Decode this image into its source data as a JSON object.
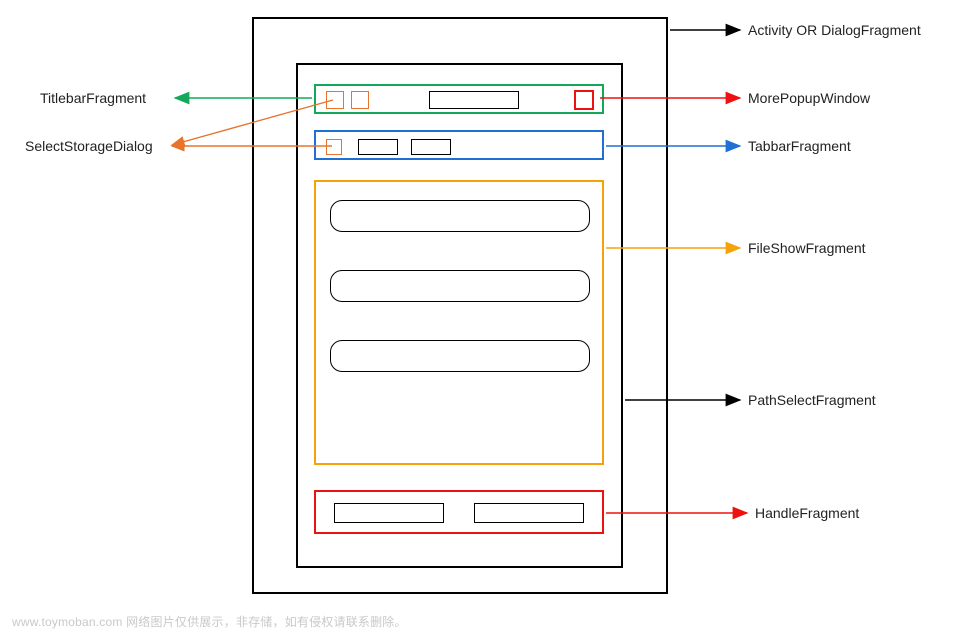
{
  "labels": {
    "activity": "Activity  OR  DialogFragment",
    "titlebar": "TitlebarFragment",
    "selectstorage": "SelectStorageDialog",
    "morepopup": "MorePopupWindow",
    "tabbar": "TabbarFragment",
    "fileshow": "FileShowFragment",
    "pathselect": "PathSelectFragment",
    "handle": "HandleFragment"
  },
  "colors": {
    "green": "#13a85a",
    "blue": "#1e6fd6",
    "orange": "#e8732c",
    "yellow": "#f5a20a",
    "red": "#e11",
    "black": "#000"
  },
  "watermark": "www.toymoban.com  网络图片仅供展示，非存储，如有侵权请联系删除。"
}
